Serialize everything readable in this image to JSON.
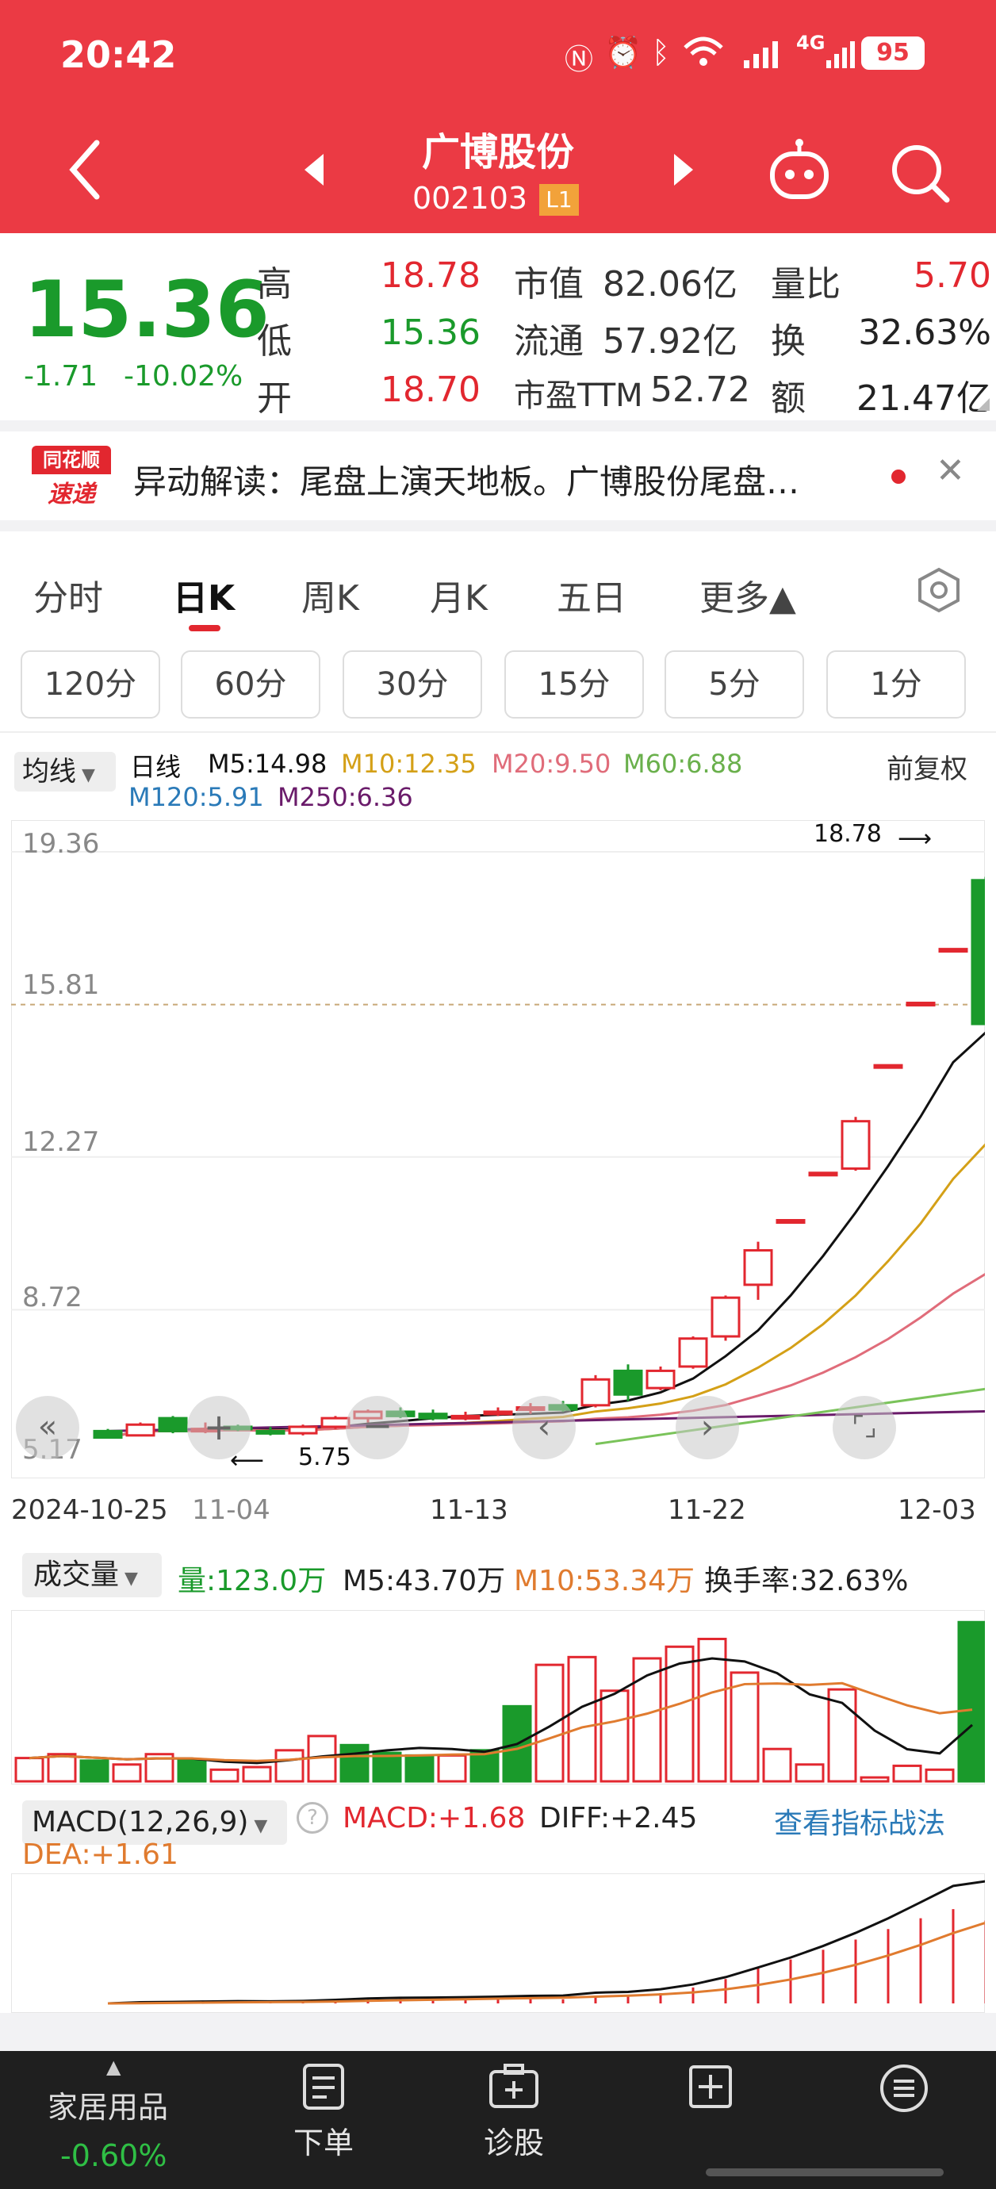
{
  "status_bar": {
    "time": "20:42",
    "battery": "95",
    "network": "4G"
  },
  "header": {
    "title": "广博股份",
    "code": "002103",
    "level_badge": "L1"
  },
  "quote": {
    "price": "15.36",
    "change": "-1.71",
    "change_pct": "-10.02%",
    "high_label": "高",
    "high": "18.78",
    "low_label": "低",
    "low": "15.36",
    "open_label": "开",
    "open": "18.70",
    "mktcap_label": "市值",
    "mktcap": "82.06亿",
    "float_label": "流通",
    "float": "57.92亿",
    "pe_label": "市盈TTM",
    "pe": "52.72",
    "volratio_label": "量比",
    "volratio": "5.70",
    "turnover_label": "换",
    "turnover": "32.63%",
    "amount_label": "额",
    "amount": "21.47亿"
  },
  "news": {
    "logo_top": "同花顺",
    "logo_bottom": "速递",
    "text": "异动解读：尾盘上演天地板。广博股份尾盘…"
  },
  "tabs": [
    {
      "label": "分时"
    },
    {
      "label": "日K"
    },
    {
      "label": "周K"
    },
    {
      "label": "月K"
    },
    {
      "label": "五日"
    },
    {
      "label": "更多▲"
    }
  ],
  "periods": [
    "120分",
    "60分",
    "30分",
    "15分",
    "5分",
    "1分"
  ],
  "ma_legend": {
    "selector": "均线",
    "kind": "日线",
    "adjust": "前复权",
    "m5": "M5:14.98",
    "m10": "M10:12.35",
    "m20": "M20:9.50",
    "m60": "M60:6.88",
    "m120": "M120:5.91",
    "m250": "M250:6.36"
  },
  "kchart": {
    "y_labels": [
      "19.36",
      "15.81",
      "12.27",
      "8.72",
      "5.17"
    ],
    "high_marker": "18.78",
    "low_marker": "5.75",
    "dates": [
      "2024-10-25",
      "11-04",
      "11-13",
      "11-22",
      "12-03"
    ]
  },
  "volume": {
    "selector": "成交量",
    "vol": "量:123.0万",
    "m5": "M5:43.70万",
    "m10": "M10:53.34万",
    "turnover": "换手率:32.63%"
  },
  "macd": {
    "selector": "MACD(12,26,9)",
    "macd": "MACD:+1.68",
    "diff": "DIFF:+2.45",
    "dea": "DEA:+1.61",
    "strategy_link": "查看指标战法"
  },
  "bottom_nav": {
    "sector_name": "家居用品",
    "sector_change": "-0.60%",
    "items": [
      {
        "label": "下单"
      },
      {
        "label": "诊股"
      },
      {
        "label": ""
      },
      {
        "label": ""
      }
    ]
  },
  "colors": {
    "up": "#e2272f",
    "down": "#1a9a2b",
    "header": "#eb3a44",
    "m5": "#111111",
    "m10": "#d4a017",
    "m20": "#e06c7a",
    "m60": "#7ac35a",
    "m120": "#2a7ab8",
    "m250": "#6a1b6a"
  },
  "chart_data": {
    "type": "candlestick",
    "ylim": [
      5.17,
      19.36
    ],
    "candles": [
      {
        "o": 5.9,
        "c": 5.75,
        "h": 5.95,
        "l": 5.75
      },
      {
        "o": 5.8,
        "c": 6.05,
        "h": 6.1,
        "l": 5.8
      },
      {
        "o": 6.2,
        "c": 5.9,
        "h": 6.25,
        "l": 5.85
      },
      {
        "o": 5.95,
        "c": 5.95,
        "h": 6.1,
        "l": 5.85
      },
      {
        "o": 6.0,
        "c": 5.95,
        "h": 6.05,
        "l": 5.9
      },
      {
        "o": 5.9,
        "c": 5.85,
        "h": 6.0,
        "l": 5.8
      },
      {
        "o": 5.85,
        "c": 6.0,
        "h": 6.05,
        "l": 5.8
      },
      {
        "o": 6.0,
        "c": 6.2,
        "h": 6.25,
        "l": 5.95
      },
      {
        "o": 6.2,
        "c": 6.35,
        "h": 6.4,
        "l": 6.1
      },
      {
        "o": 6.35,
        "c": 6.25,
        "h": 6.45,
        "l": 6.2
      },
      {
        "o": 6.3,
        "c": 6.2,
        "h": 6.4,
        "l": 6.15
      },
      {
        "o": 6.2,
        "c": 6.25,
        "h": 6.35,
        "l": 6.15
      },
      {
        "o": 6.3,
        "c": 6.35,
        "h": 6.45,
        "l": 6.25
      },
      {
        "o": 6.4,
        "c": 6.45,
        "h": 6.55,
        "l": 6.3
      },
      {
        "o": 6.5,
        "c": 6.4,
        "h": 6.6,
        "l": 6.35
      },
      {
        "o": 6.5,
        "c": 7.1,
        "h": 7.2,
        "l": 6.45
      },
      {
        "o": 7.3,
        "c": 6.75,
        "h": 7.45,
        "l": 6.6
      },
      {
        "o": 6.9,
        "c": 7.3,
        "h": 7.4,
        "l": 6.85
      },
      {
        "o": 7.4,
        "c": 8.05,
        "h": 8.1,
        "l": 7.35
      },
      {
        "o": 8.1,
        "c": 9.0,
        "h": 9.05,
        "l": 8.0
      },
      {
        "o": 9.3,
        "c": 10.1,
        "h": 10.3,
        "l": 8.95
      },
      {
        "o": 10.8,
        "c": 10.8,
        "h": 10.8,
        "l": 10.8
      },
      {
        "o": 11.9,
        "c": 11.9,
        "h": 11.9,
        "l": 11.9
      },
      {
        "o": 12.0,
        "c": 13.1,
        "h": 13.2,
        "l": 11.95
      },
      {
        "o": 14.4,
        "c": 14.4,
        "h": 14.4,
        "l": 14.4
      },
      {
        "o": 15.85,
        "c": 15.85,
        "h": 15.85,
        "l": 15.85
      },
      {
        "o": 17.1,
        "c": 17.1,
        "h": 17.1,
        "l": 17.1
      },
      {
        "o": 18.7,
        "c": 15.36,
        "h": 18.78,
        "l": 15.36
      }
    ],
    "volume": [
      18,
      21,
      16,
      13,
      21,
      17,
      9,
      11,
      24,
      35,
      28,
      22,
      20,
      20,
      24,
      58,
      90,
      96,
      70,
      95,
      104,
      110,
      84,
      25,
      13,
      71,
      3,
      12,
      9,
      123
    ],
    "volume_up": [
      true,
      true,
      false,
      true,
      true,
      false,
      true,
      true,
      true,
      true,
      false,
      false,
      false,
      true,
      false,
      false,
      true,
      true,
      true,
      true,
      true,
      true,
      true,
      true,
      true,
      true,
      true,
      true,
      true,
      false
    ]
  }
}
